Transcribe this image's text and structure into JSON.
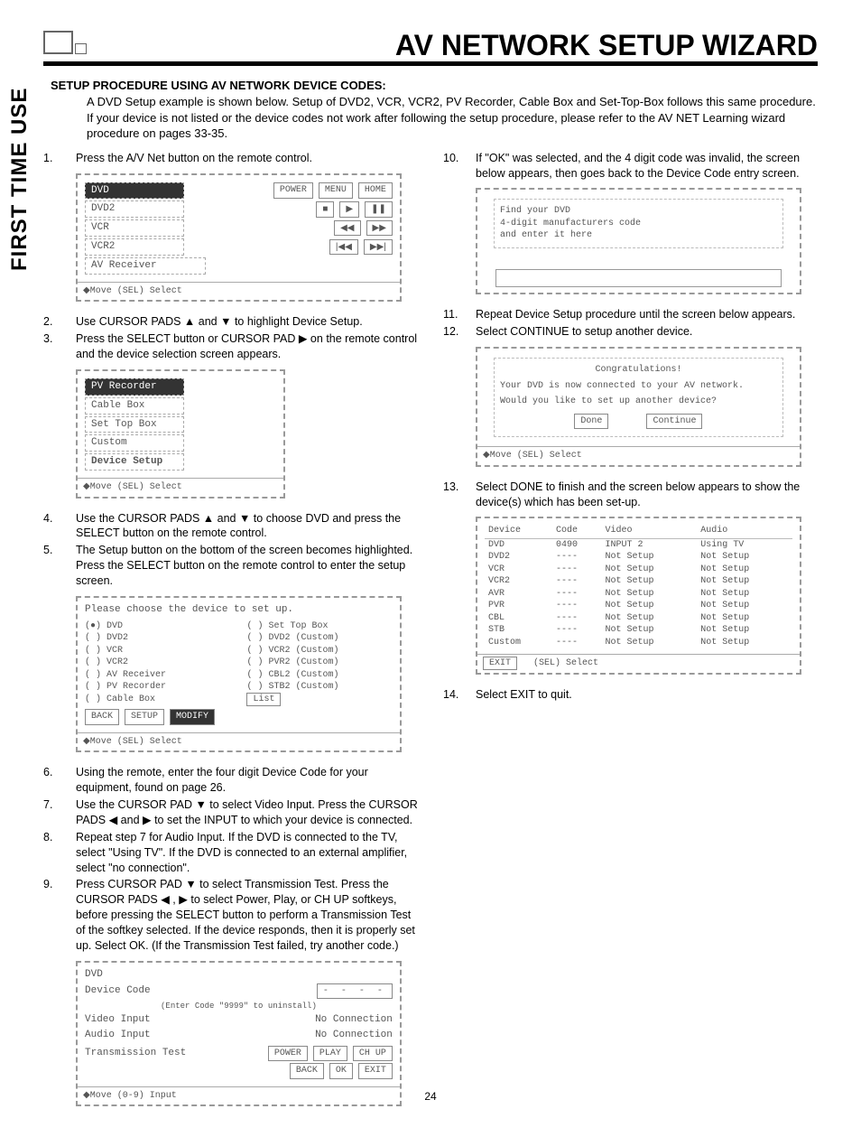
{
  "header": {
    "title": "AV NETWORK SETUP WIZARD"
  },
  "section": {
    "heading": "SETUP PROCEDURE USING AV NETWORK DEVICE CODES:",
    "intro": "A DVD Setup example is shown below. Setup of DVD2, VCR, VCR2, PV Recorder, Cable Box and Set-Top-Box follows this same procedure. If your device is not listed or the device codes not work after following the setup procedure, please refer to the AV NET Learning wizard procedure on pages 33-35."
  },
  "sidebar": "FIRST TIME USE",
  "steps": {
    "s1": "Press the A/V Net button on the remote control.",
    "s2": "Use CURSOR PADS ▲ and ▼ to highlight Device Setup.",
    "s3": "Press the SELECT button or CURSOR PAD ▶ on the remote control and the device selection screen appears.",
    "s4": "Use the CURSOR PADS ▲ and ▼ to choose DVD and press the  SELECT button on the remote control.",
    "s5": "The Setup button on the bottom of the screen becomes highlighted. Press the SELECT button on the remote control to enter the setup screen.",
    "s6": "Using the remote, enter the four digit Device Code for your equipment, found on page 26.",
    "s7": "Use the CURSOR PAD ▼ to select Video Input. Press the CURSOR PADS ◀ and ▶ to set the INPUT to which your device is connected.",
    "s8": "Repeat step 7 for Audio Input. If the DVD is connected to the TV, select \"Using TV\". If the DVD is connected to an external amplifier, select \"no connection\".",
    "s9": "Press CURSOR PAD ▼ to select Transmission Test. Press the CURSOR PADS ◀ , ▶ to select Power, Play, or CH UP softkeys, before pressing the SELECT button to perform a Transmission Test of the softkey selected.  If the device responds, then it is properly set up. Select OK.  (If the Transmission Test failed, try another code.)",
    "s10": "If \"OK\" was selected, and the 4 digit code was invalid, the screen below appears, then goes back to the Device Code entry screen.",
    "s11": "Repeat Device Setup procedure until the screen below appears.",
    "s12": "Select CONTINUE to setup another device.",
    "s13": "Select DONE to finish and the screen below appears to show the device(s) which has been set-up.",
    "s14": "Select EXIT to quit."
  },
  "fig1": {
    "rows": [
      "DVD",
      "DVD2",
      "VCR",
      "VCR2",
      "AV Receiver"
    ],
    "btns": [
      "POWER",
      "MENU",
      "HOME"
    ],
    "sym_stop": "■",
    "sym_play": "▶",
    "sym_pause": "❚❚",
    "sym_rew": "◀◀",
    "sym_ff": "▶▶",
    "sym_prev": "|◀◀",
    "sym_next": "▶▶|",
    "footer": "◆Move   (SEL) Select"
  },
  "fig2": {
    "rows": [
      "PV Recorder",
      "Cable Box",
      "Set Top Box",
      "Custom",
      "Device Setup"
    ],
    "footer": "◆Move   (SEL) Select"
  },
  "fig3": {
    "prompt": "Please choose the device to set up.",
    "left": [
      "(●) DVD",
      "( ) DVD2",
      "( ) VCR",
      "( ) VCR2",
      "( ) AV Receiver",
      "( ) PV Recorder",
      "( ) Cable Box"
    ],
    "right": [
      "( ) Set Top Box",
      "( ) DVD2 (Custom)",
      "( ) VCR2 (Custom)",
      "( ) PVR2 (Custom)",
      "( ) CBL2 (Custom)",
      "( ) STB2 (Custom)",
      "List"
    ],
    "btns": [
      "BACK",
      "SETUP",
      "MODIFY"
    ],
    "footer": "◆Move   (SEL) Select"
  },
  "fig4": {
    "title": "DVD",
    "code_label": "Device Code",
    "code_hint": "(Enter Code \"9999\" to uninstall)",
    "vi_label": "Video Input",
    "vi_value": "No Connection",
    "ai_label": "Audio Input",
    "ai_value": "No Connection",
    "tt_label": "Transmission Test",
    "btns": [
      "POWER",
      "PLAY",
      "CH UP",
      "BACK",
      "OK",
      "EXIT"
    ],
    "footer": "◆Move   (0-9) Input"
  },
  "fig5": {
    "msg": "Find your DVD\n4-digit manufacturers code\nand enter it here"
  },
  "fig6": {
    "title": "Congratulations!",
    "msg1": "Your DVD is now connected to your AV network.",
    "msg2": "Would you like to set up another device?",
    "done": "Done",
    "continue": "Continue",
    "footer": "◆Move   (SEL) Select"
  },
  "fig7": {
    "headers": [
      "Device",
      "Code",
      "Video",
      "Audio"
    ],
    "rows": [
      [
        "DVD",
        "0490",
        "INPUT 2",
        "Using TV"
      ],
      [
        "DVD2",
        "----",
        "Not Setup",
        "Not Setup"
      ],
      [
        "VCR",
        "----",
        "Not Setup",
        "Not Setup"
      ],
      [
        "VCR2",
        "----",
        "Not Setup",
        "Not Setup"
      ],
      [
        "AVR",
        "----",
        "Not Setup",
        "Not Setup"
      ],
      [
        "PVR",
        "----",
        "Not Setup",
        "Not Setup"
      ],
      [
        "CBL",
        "----",
        "Not Setup",
        "Not Setup"
      ],
      [
        "STB",
        "----",
        "Not Setup",
        "Not Setup"
      ],
      [
        "Custom",
        "----",
        "Not Setup",
        "Not Setup"
      ]
    ],
    "exit": "EXIT",
    "footer": "(SEL) Select"
  },
  "page_number": "24"
}
